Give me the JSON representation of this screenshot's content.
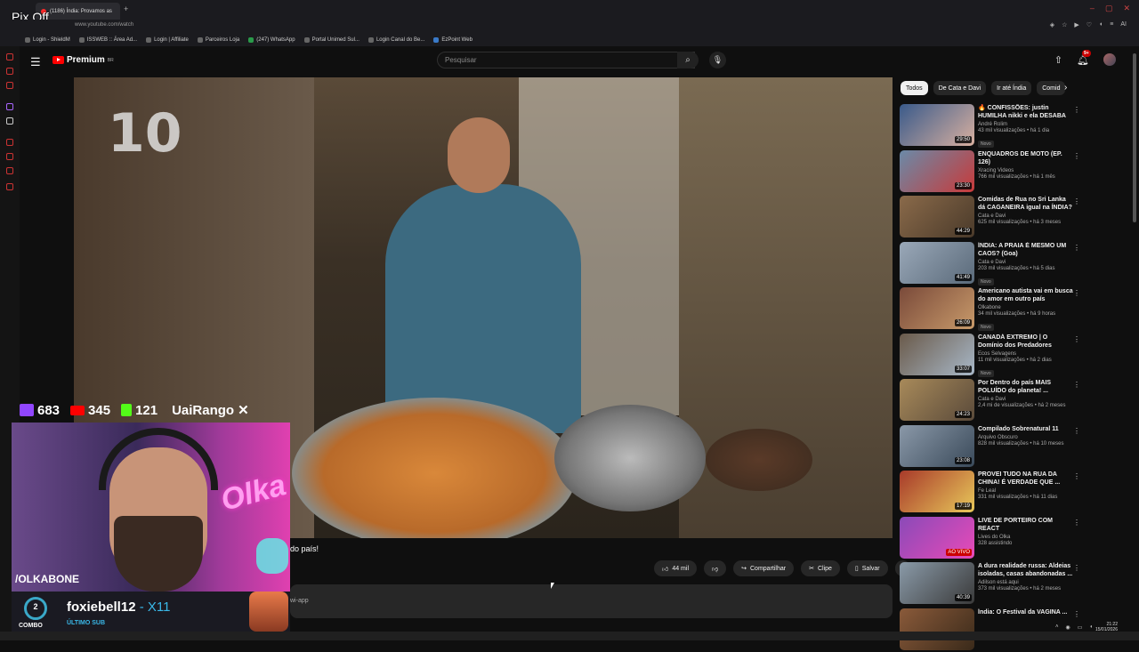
{
  "overlay_top": {
    "pix_off": "Pix Off"
  },
  "browser": {
    "active_tab": "(1186) Índia: Provamos as",
    "new_tab": "+",
    "url": "www.youtube.com/watch",
    "bookmarks": [
      "Login - ShieldM",
      "ISSWEB :: Área Ad...",
      "Login | Affiliate",
      "Parceiros Loja",
      "(247) WhatsApp",
      "Portal Unimed Sul...",
      "Login Canal do Be...",
      "EzPoint Web"
    ],
    "ai_label": "AI"
  },
  "yt": {
    "logo_text": "Premium",
    "logo_sup": "BR",
    "search_placeholder": "Pesquisar",
    "notif_count": "9+"
  },
  "video": {
    "overlay_number": "10",
    "title_fragment": "do país!",
    "likes": "44 mil",
    "share": "Compartilhar",
    "clip": "Clipe",
    "save": "Salvar",
    "desc_fragment": "wi-app"
  },
  "stream": {
    "stats": [
      {
        "platform": "twitch",
        "color": "#9146ff",
        "value": "683"
      },
      {
        "platform": "youtube",
        "color": "#ff0000",
        "value": "345"
      },
      {
        "platform": "kick",
        "color": "#53fc18",
        "value": "121"
      }
    ],
    "brand": "UaiRango",
    "neon_sign": "Olka",
    "handle": "/OLKABONE",
    "combo_number": "2",
    "combo_label": "COMBO",
    "sub_name": "foxiebell12",
    "sub_multiplier": "- X11",
    "sub_label": "ÚLTIMO SUB"
  },
  "sidebar": {
    "chips": [
      "Todos",
      "De Cata e Davi",
      "Ir até Índia",
      "Comid"
    ],
    "recs": [
      {
        "title": "🔥 CONFISSÕES: justin HUMILHA nikki e ela DESABA",
        "channel": "André Rolim",
        "meta": "43 mil visualizações • há 1 dia",
        "badge": "Novo",
        "duration": "29:50",
        "c1": "#3a5a8a",
        "c2": "#d8b0a0"
      },
      {
        "title": "ENQUADROS DE MOTO (EP. 126)",
        "channel": "Xracing Videos",
        "meta": "766 mil visualizações • há 1 mês",
        "badge": "",
        "duration": "23:30",
        "c1": "#6a8aa8",
        "c2": "#c83a3a"
      },
      {
        "title": "Comidas de Rua no Sri Lanka dá CAGANEIRA igual na ÍNDIA? ...",
        "channel": "Cata e Davi",
        "meta": "625 mil visualizações • há 3 meses",
        "badge": "",
        "duration": "44:29",
        "c1": "#8a6a4a",
        "c2": "#4a3a2a"
      },
      {
        "title": "ÍNDIA: A PRAIA É MESMO UM CAOS? (Goa)",
        "channel": "Cata e Davi",
        "meta": "203 mil visualizações • há 5 dias",
        "badge": "Novo",
        "duration": "41:49",
        "c1": "#9aa8b8",
        "c2": "#5a6a7a"
      },
      {
        "title": "Americano autista vai em busca do amor em outro país",
        "channel": "Olkabone",
        "meta": "34 mil visualizações • há 9 horas",
        "badge": "Novo",
        "duration": "26:09",
        "c1": "#7a4a3a",
        "c2": "#c89a6a"
      },
      {
        "title": "CANADÁ EXTREMO | O Domínio dos Predadores Ferozes | ...",
        "channel": "Ecos Selvagens",
        "meta": "11 mil visualizações • há 2 dias",
        "badge": "Novo",
        "duration": "33:07",
        "c1": "#6a5a4a",
        "c2": "#a8b8c8"
      },
      {
        "title": "Por Dentro do país MAIS POLUÍDO do planeta! ...",
        "channel": "Cata e Davi",
        "meta": "2,4 mi de visualizações • há 2 meses",
        "badge": "",
        "duration": "24:23",
        "c1": "#a88a5a",
        "c2": "#5a4a3a"
      },
      {
        "title": "Compilado Sobrenatural 11",
        "channel": "Arquivo Obscuro",
        "meta": "828 mil visualizações • há 10 meses",
        "badge": "",
        "duration": "23:08",
        "c1": "#8a98a8",
        "c2": "#3a4a5a"
      },
      {
        "title": "PROVEI TUDO NA RUA DA CHINA! É VERDADE QUE ...",
        "channel": "Fe Leal",
        "meta": "331 mil visualizações • há 11 dias",
        "badge": "",
        "duration": "17:19",
        "c1": "#a83a2a",
        "c2": "#e8c85a"
      },
      {
        "title": "LIVE DE PORTEIRO COM REACT",
        "channel": "Lives do Olka",
        "meta": "328 assistindo",
        "badge": "",
        "duration": "AO VIVO",
        "c1": "#8a4ab8",
        "c2": "#e84ab8"
      },
      {
        "title": "A dura realidade russa: Aldeias isoladas, casas abandonadas ...",
        "channel": "Adilson está aqui",
        "meta": "373 mil visualizações • há 2 meses",
        "badge": "",
        "duration": "40:39",
        "c1": "#8a9aa8",
        "c2": "#3a3a3a"
      },
      {
        "title": "Índia: O Festival da VAGINA ...",
        "channel": "",
        "meta": "",
        "badge": "",
        "duration": "",
        "c1": "#8a5a3a",
        "c2": "#3a2a1a"
      }
    ]
  },
  "system": {
    "time": "21:22",
    "date": "15/01/2026"
  }
}
